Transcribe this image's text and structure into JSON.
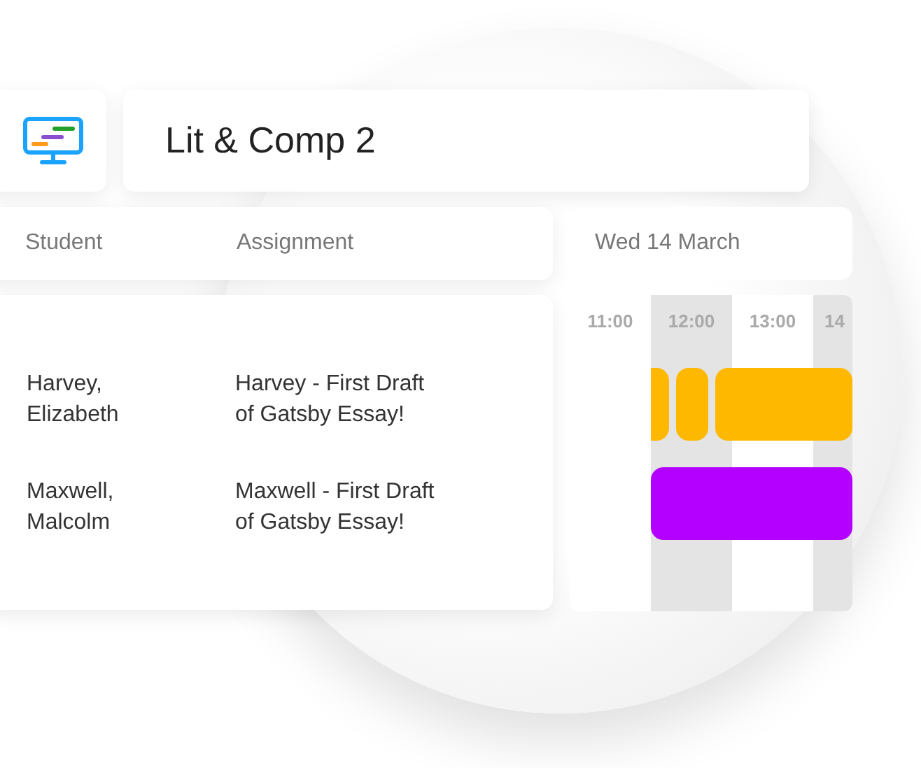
{
  "class_title": "Lit & Comp 2",
  "columns": [
    "Student",
    "Assignment"
  ],
  "rows": [
    {
      "student": "Harvey,\nElizabeth",
      "assignment": "Harvey - First Draft\nof Gatsby Essay!"
    },
    {
      "student": "Maxwell,\nMalcolm",
      "assignment": "Maxwell - First Draft\nof Gatsby Essay!"
    }
  ],
  "date": "Wed 14 March",
  "hours": [
    "11:00",
    "12:00",
    "13:00",
    "14"
  ],
  "bars": [
    {
      "segments": [
        {
          "color": "#ffb800"
        },
        {
          "color": "#ffb800"
        },
        {
          "color": "#ffb800"
        }
      ]
    },
    {
      "segments": [
        {
          "color": "#b400ff"
        }
      ]
    }
  ]
}
